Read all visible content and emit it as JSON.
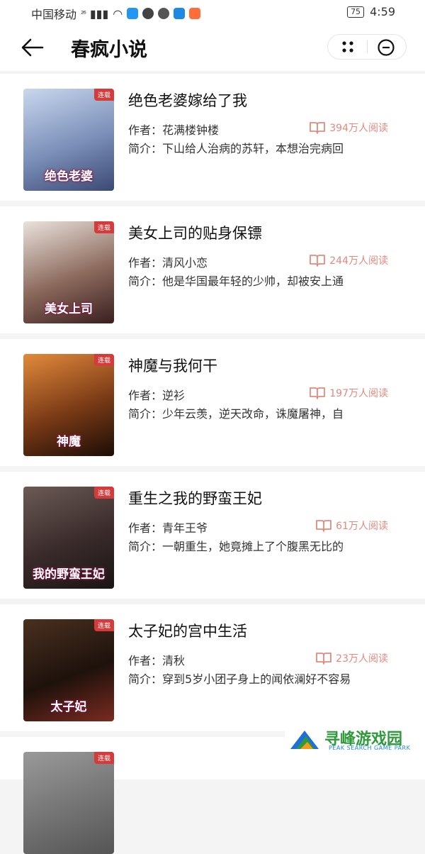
{
  "status_bar": {
    "carrier": "中国移动",
    "network": "²⁶",
    "battery": "75",
    "time": "4:59"
  },
  "header": {
    "title": "春疯小说",
    "back_icon": "back-arrow-icon",
    "more_icon": "more-dots-icon",
    "close_icon": "close-circle-icon"
  },
  "colors": {
    "accent": "#e08a7e",
    "tag": "#d63b3b"
  },
  "labels": {
    "author_prefix": "作者：",
    "intro_prefix": "简介："
  },
  "books": [
    {
      "title": "绝色老婆嫁给了我",
      "author": "花满楼钟楼",
      "reads": "394万人阅读",
      "intro": "下山给人治病的苏轩，本想治完病回",
      "tag": "连载",
      "cover_title": "绝色老婆",
      "cover_colors": [
        "#c9d7ee",
        "#7b8fb8",
        "#3b4a74"
      ]
    },
    {
      "title": "美女上司的贴身保镖",
      "author": "清风小恋",
      "reads": "244万人阅读",
      "intro": "他是华国最年轻的少帅，却被安上通",
      "tag": "连载",
      "cover_title": "美女上司",
      "cover_colors": [
        "#e9e2dc",
        "#8c6a5d",
        "#3a1f1f"
      ]
    },
    {
      "title": "神魔与我何干",
      "author": "逆衫",
      "reads": "197万人阅读",
      "intro": "少年云羡，逆天改命，诛魔屠神，自",
      "tag": "连载",
      "cover_title": "神魔",
      "cover_colors": [
        "#e28a3b",
        "#7a3a16",
        "#1c0d06"
      ]
    },
    {
      "title": "重生之我的野蛮王妃",
      "author": "青年王爷",
      "reads": "61万人阅读",
      "intro": "一朝重生，她竟摊上了个腹黑无比的",
      "tag": "连载",
      "cover_title": "我的野蛮王妃",
      "cover_colors": [
        "#6b5a55",
        "#3a2b2b",
        "#1a1414"
      ]
    },
    {
      "title": "太子妃的宫中生活",
      "author": "清秋",
      "reads": "23万人阅读",
      "intro": "穿到5岁小团子身上的闻依澜好不容易",
      "tag": "连载",
      "cover_title": "太子妃",
      "cover_colors": [
        "#4a3020",
        "#1e120c",
        "#7a2b20"
      ]
    }
  ],
  "partial_card": {
    "tag": "连载"
  },
  "watermark": {
    "name": "寻峰游戏园",
    "sub": "PEAK SEARCH GAME PARK"
  }
}
